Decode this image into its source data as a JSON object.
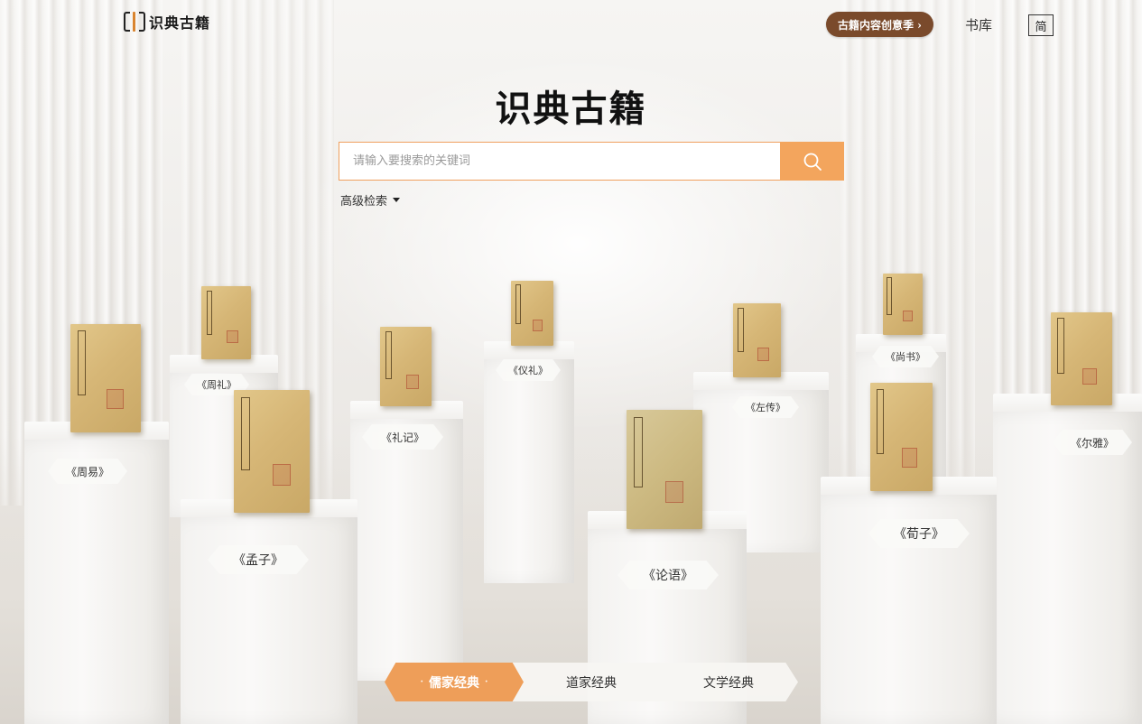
{
  "header": {
    "logo_text": "识典古籍",
    "promo_label": "古籍内容创意季 ›",
    "nav_library": "书库",
    "lang_toggle": "简"
  },
  "hero": {
    "title": "识典古籍",
    "search_placeholder": "请输入要搜索的关键词",
    "advanced_search": "高级检索"
  },
  "exhibits": [
    {
      "label": "《周易》"
    },
    {
      "label": "《周礼》"
    },
    {
      "label": "《孟子》"
    },
    {
      "label": "《礼记》"
    },
    {
      "label": "《仪礼》"
    },
    {
      "label": "《论语》"
    },
    {
      "label": "《左传》"
    },
    {
      "label": "《尚书》"
    },
    {
      "label": "《荀子》"
    },
    {
      "label": "《尔雅》"
    }
  ],
  "category_tabs": [
    {
      "label": "儒家经典",
      "active": true
    },
    {
      "label": "道家经典",
      "active": false
    },
    {
      "label": "文学经典",
      "active": false
    }
  ],
  "colors": {
    "accent_orange": "#f3a55d",
    "promo_brown": "#7a4a2b",
    "book_tan": "#d6b676"
  },
  "icons": {
    "search": "search-icon",
    "dropdown": "caret-down-icon"
  }
}
